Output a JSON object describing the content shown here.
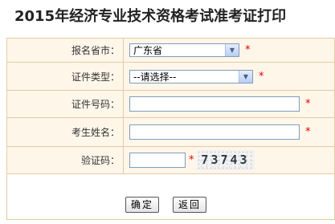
{
  "page": {
    "title": "2015年经济专业技术资格考试准考证打印"
  },
  "form": {
    "province": {
      "label": "报名省市：",
      "selected": "广东省"
    },
    "id_type": {
      "label": "证件类型：",
      "selected": "--请选择--"
    },
    "id_number": {
      "label": "证件号码："
    },
    "name": {
      "label": "考生姓名："
    },
    "captcha": {
      "label": "验证码：",
      "image_text": "73743"
    },
    "required_mark": "*"
  },
  "buttons": {
    "confirm": "确定",
    "back": "返回"
  },
  "colors": {
    "row_background": "#fff6ea",
    "border": "#e8c9a2",
    "required": "#e00000"
  }
}
